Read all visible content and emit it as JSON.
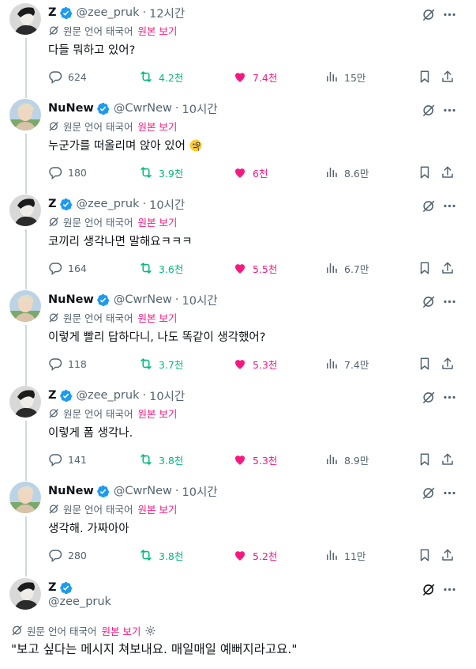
{
  "translate": {
    "label": "원문 언어 태국어",
    "show_original": "원본 보기"
  },
  "tweets": [
    {
      "name": "Z",
      "handle": "@zee_pruk",
      "time": "12시간",
      "text": "다들 뭐하고 있어?",
      "replies": "624",
      "retweets": "4.2천",
      "likes": "7.4천",
      "views": "15만"
    },
    {
      "name": "NuNew",
      "handle": "@CwrNew",
      "time": "10시간",
      "text": "누군가를 떠올리며 앉아 있어",
      "replies": "180",
      "retweets": "3.9천",
      "likes": "6천",
      "views": "8.6만"
    },
    {
      "name": "Z",
      "handle": "@zee_pruk",
      "time": "10시간",
      "text": "코끼리 생각나면 말해요ㅋㅋㅋ",
      "replies": "164",
      "retweets": "3.6천",
      "likes": "5.5천",
      "views": "6.7만"
    },
    {
      "name": "NuNew",
      "handle": "@CwrNew",
      "time": "10시간",
      "text": "이렇게 빨리 답하다니, 나도 똑같이 생각했어?",
      "replies": "118",
      "retweets": "3.7천",
      "likes": "5.3천",
      "views": "7.4만"
    },
    {
      "name": "Z",
      "handle": "@zee_pruk",
      "time": "10시간",
      "text": "이렇게 폼 생각나.",
      "replies": "141",
      "retweets": "3.8천",
      "likes": "5.3천",
      "views": "8.9만"
    },
    {
      "name": "NuNew",
      "handle": "@CwrNew",
      "time": "10시간",
      "text": "생각해. 가짜아아",
      "replies": "280",
      "retweets": "3.8천",
      "likes": "5.2천",
      "views": "11만"
    }
  ],
  "main_tweet": {
    "name": "Z",
    "handle": "@zee_pruk",
    "text": "\"보고 싶다는 메시지 쳐보내요. 매일매일 예뻐지라고요.\""
  },
  "colors": {
    "like": "#f91880",
    "retweet": "#00ba7c",
    "verified": "#1d9bf0",
    "secondary_text": "#536471"
  },
  "icons": {
    "reply": "reply-icon",
    "retweet": "retweet-icon",
    "like": "heart-icon",
    "views": "views-icon",
    "bookmark": "bookmark-icon",
    "share": "share-icon",
    "grok": "grok-icon",
    "more": "more-icon",
    "verified": "verified-badge-icon",
    "translate": "translate-icon",
    "emoji": "monocle-face-emoji"
  }
}
